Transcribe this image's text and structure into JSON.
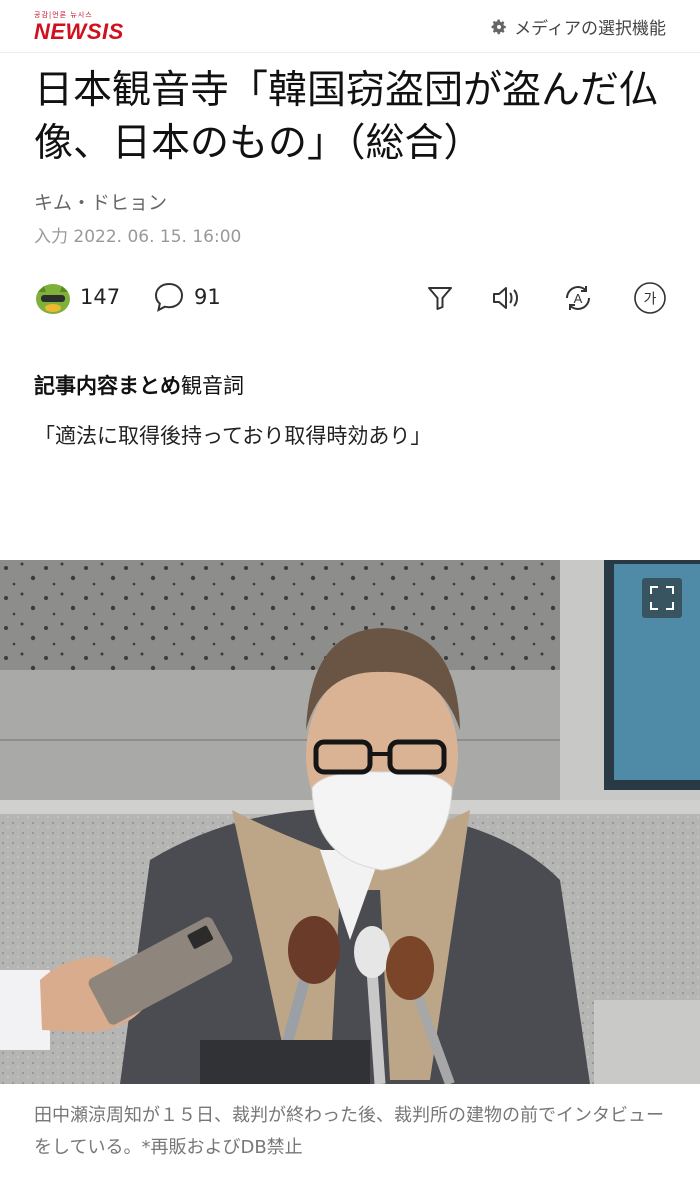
{
  "header": {
    "logo_small": "공감|언론 뉴시스",
    "logo_main": "NEWSIS",
    "media_select_label": "メディアの選択機能"
  },
  "article": {
    "headline": "日本観音寺「韓国窃盗団が盗んだ仏像、日本のもの」（総合）",
    "author": "キム・ドヒョン",
    "date": "入力 2022. 06. 15. 16:00"
  },
  "toolbar": {
    "reaction_count": "147",
    "comment_count": "91",
    "icons": [
      "reaction-emoji-icon",
      "comment-icon",
      "filter-icon",
      "speaker-icon",
      "translate-icon",
      "font-size-icon"
    ]
  },
  "summary": {
    "title_bold": "記事内容まとめ",
    "title_rest": "観音詞",
    "body": "「適法に取得後持っており取得時効あり」"
  },
  "photo": {
    "caption": "田中瀬涼周知が１５日、裁判が終わった後、裁判所の建物の前でインタビューをしている。*再販およびDB禁止"
  },
  "colors": {
    "brand_red": "#d0101c",
    "text_gray": "#777777"
  }
}
